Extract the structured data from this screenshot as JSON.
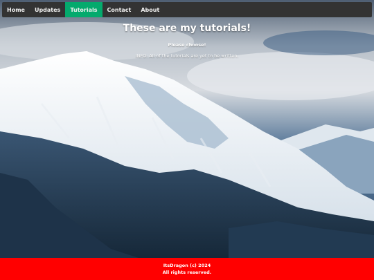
{
  "navbar": {
    "items": [
      {
        "label": "Home",
        "active": false
      },
      {
        "label": "Updates",
        "active": false
      },
      {
        "label": "Tutorials",
        "active": true
      },
      {
        "label": "Contact",
        "active": false
      },
      {
        "label": "About",
        "active": false
      }
    ]
  },
  "main": {
    "title": "These are my tutorials!",
    "subtitle": "Please choose!",
    "info": "INFO: All of the tutorials are yet to be written."
  },
  "footer": {
    "line1": "ItsDragon (c) 2024",
    "line2": "All rights reserved."
  },
  "colors": {
    "navbar_bg": "#333333",
    "active_tab": "#04aa6d",
    "footer_bg": "#ff0000"
  }
}
